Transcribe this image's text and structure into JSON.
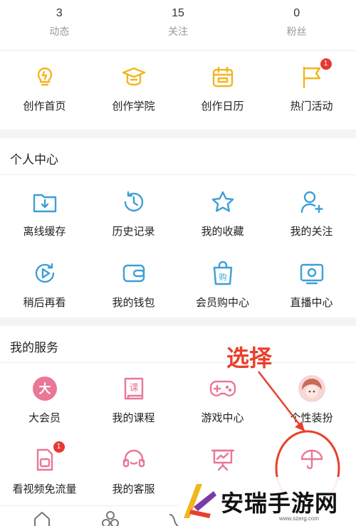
{
  "stats": [
    {
      "value": "3",
      "label": "动态"
    },
    {
      "value": "15",
      "label": "关注"
    },
    {
      "value": "0",
      "label": "粉丝"
    }
  ],
  "creator": [
    {
      "label": "创作首页",
      "icon": "lightbulb-icon"
    },
    {
      "label": "创作学院",
      "icon": "graduation-cap-icon"
    },
    {
      "label": "创作日历",
      "icon": "calendar-icon"
    },
    {
      "label": "热门活动",
      "icon": "flag-icon",
      "badge": "1"
    }
  ],
  "personal": {
    "title": "个人中心",
    "items": [
      {
        "label": "离线缓存",
        "icon": "download-folder-icon"
      },
      {
        "label": "历史记录",
        "icon": "history-clock-icon"
      },
      {
        "label": "我的收藏",
        "icon": "star-icon"
      },
      {
        "label": "我的关注",
        "icon": "add-user-icon"
      },
      {
        "label": "稍后再看",
        "icon": "play-later-icon"
      },
      {
        "label": "我的钱包",
        "icon": "wallet-icon"
      },
      {
        "label": "会员购中心",
        "icon": "shopping-bag-icon"
      },
      {
        "label": "直播中心",
        "icon": "tv-icon"
      }
    ]
  },
  "services": {
    "title": "我的服务",
    "items": [
      {
        "label": "大会员",
        "icon": "vip-icon",
        "glyph": "大"
      },
      {
        "label": "我的课程",
        "icon": "course-book-icon",
        "glyph": "课"
      },
      {
        "label": "游戏中心",
        "icon": "gamepad-icon"
      },
      {
        "label": "个性装扮",
        "icon": "avatar-icon"
      },
      {
        "label": "看视频免流量",
        "icon": "sim-card-icon",
        "badge": "1"
      },
      {
        "label": "我的客服",
        "icon": "headset-icon"
      },
      {
        "label": "",
        "icon": "presentation-icon"
      },
      {
        "label": "",
        "icon": "umbrella-icon"
      }
    ]
  },
  "annotation": {
    "text": "选择"
  },
  "watermark": {
    "text": "安瑞手游网",
    "url": "www.szerg.com"
  },
  "colors": {
    "yellow": "#f2b51d",
    "blue": "#3d9fd6",
    "pink": "#e97795",
    "red": "#e8402c"
  }
}
